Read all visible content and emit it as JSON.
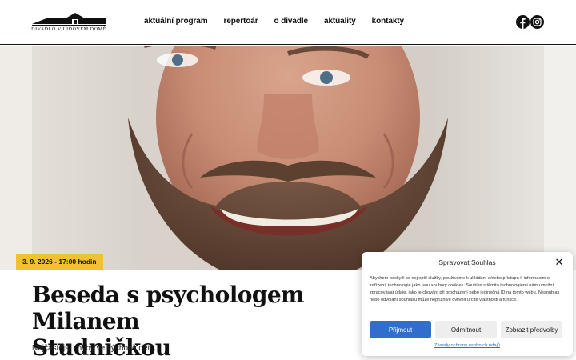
{
  "header": {
    "logo_text": "DIVADLO V LIDOVÉM DOMĚ",
    "nav": [
      {
        "label": "aktuální program"
      },
      {
        "label": "repertoár"
      },
      {
        "label": "o divadle"
      },
      {
        "label": "aktuality"
      },
      {
        "label": "kontakty"
      }
    ],
    "social": [
      {
        "icon": "facebook-icon"
      },
      {
        "icon": "instagram-icon"
      }
    ]
  },
  "event": {
    "date": "3. 9. 2026 - 17:00 hodin",
    "title_line1": "Beseda s psychologem Milanem",
    "title_line2": "Studničkou",
    "subtitle": "Nejčastější chyby ve výchově dětí.",
    "badge_color": "#f0c232"
  },
  "cookie": {
    "title": "Spravovat Souhlas",
    "text": "Abychom poskytli co nejlepší služby, používáme k ukládání a/nebo přístupu k informacím o zařízení, technologie jako jsou soubory cookies. Souhlas s těmito technologiemi nám umožní zpracovávat údaje, jako je chování při procházení nebo jedinečná ID na tomto webu. Nesouhlas nebo odvolání souhlasu může nepříznivě ovlivnit určité vlastnosti a funkce.",
    "accept_label": "Přijmout",
    "deny_label": "Odmítnout",
    "prefs_label": "Zobrazit předvolby",
    "policy_link": "Zásady ochrany osobních údajů",
    "accent_color": "#2f6fcb"
  }
}
